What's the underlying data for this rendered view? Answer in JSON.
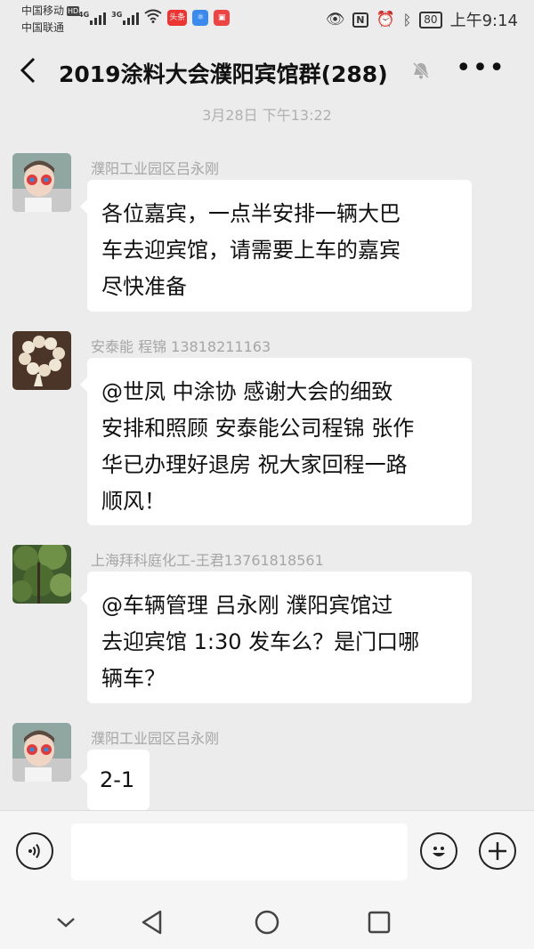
{
  "status_bar": {
    "carrier_1": "中国移动",
    "carrier_2": "中国联通",
    "hd_badge": "HD",
    "net_1": "4G",
    "net_2": "3G",
    "app_badge_1": "头条",
    "battery": "80",
    "time": "上午9:14",
    "icons": [
      "eye-icon",
      "nfc-icon",
      "alarm-icon",
      "bluetooth-icon",
      "wifi-icon"
    ]
  },
  "header": {
    "title": "2019涂料大会濮阳宾馆群(288)",
    "back_icon": "chevron-left-icon",
    "mute_icon": "bell-muted-icon",
    "more_icon": "more-dots-icon"
  },
  "chat": {
    "timestamp": "3月28日 下午13:22",
    "messages": [
      {
        "sender": "濮阳工业园区吕永刚",
        "text": "各位嘉宾，一点半安排一辆大巴\n车去迎宾馆，请需要上车的嘉宾\n尽快准备"
      },
      {
        "sender": "安泰能 程锦 13818211163",
        "text": "@世凤  中涂协  感谢大会的细致\n安排和照顾 安泰能公司程锦 张作\n华已办理好退房 祝大家回程一路\n顺风！"
      },
      {
        "sender": "上海拜科庭化工-王君13761818561",
        "text": "@车辆管理  吕永刚  濮阳宾馆过\n去迎宾馆 1:30 发车么？是门口哪\n辆车？"
      },
      {
        "sender": "濮阳工业园区吕永刚",
        "text": "2-1"
      }
    ]
  },
  "input_bar": {
    "placeholder": "",
    "voice_icon": "voice-icon",
    "emoji_icon": "emoji-icon",
    "plus_icon": "plus-icon"
  },
  "nav_bar": {
    "icons": [
      "chevron-down-icon",
      "back-triangle-icon",
      "home-circle-icon",
      "recent-square-icon"
    ]
  }
}
